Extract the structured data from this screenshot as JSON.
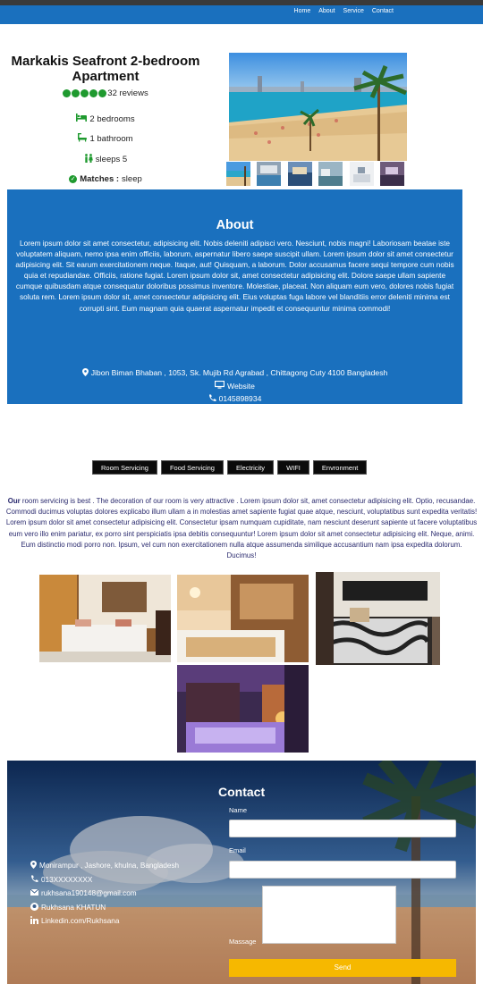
{
  "nav": {
    "links": [
      "Home",
      "About",
      "Service",
      "Contact"
    ]
  },
  "listing": {
    "title": "Markakis Seafront 2-bedroom Apartment",
    "rating_stars": 5,
    "reviews": "32 reviews",
    "bedrooms": "2 bedrooms",
    "bathrooms": "1 bathroom",
    "sleeps": "sleeps 5",
    "match_label": "Matches :",
    "match_value": "sleep"
  },
  "about": {
    "heading": "About",
    "body": "Lorem ipsum dolor sit amet consectetur, adipisicing elit. Nobis deleniti adipisci vero. Nesciunt, nobis magni! Laboriosam beatae iste voluptatem aliquam, nemo ipsa enim officiis, laborum, aspernatur libero saepe suscipit ullam. Lorem ipsum dolor sit amet consectetur adipisicing elit. Sit earum exercitationem neque. Itaque, aut! Quisquam, a laborum. Dolor accusamus facere sequi tempore cum nobis quia et repudiandae. Officiis, ratione fugiat. Lorem ipsum dolor sit, amet consectetur adipisicing elit. Dolore saepe ullam sapiente cumque quibusdam atque consequatur doloribus possimus inventore. Molestiae, placeat. Non aliquam eum vero, dolores nobis fugiat soluta rem. Lorem ipsum dolor sit, amet consectetur adipisicing elit. Eius voluptas fuga labore vel blanditiis error deleniti minima est corrupti sint. Eum magnam quia quaerat aspernatur impedit et consequuntur minima commodi!",
    "address": "Jibon Biman Bhaban , 1053, Sk. Mujib Rd Agrabad , Chittagong Cuty 4100 Bangladesh",
    "website": "Website",
    "phone": "0145898934"
  },
  "service_tabs": [
    "Room Servicing",
    "Food Servicing",
    "Electricity",
    "WIFI",
    "Envronment"
  ],
  "service": {
    "lead": "Our",
    "body": " room servicing is best . The decoration of our room is very attractive . Lorem ipsum dolor sit, amet consectetur adipisicing elit. Optio, recusandae. Commodi ducimus voluptas dolores explicabo illum ullam a in molestias amet sapiente fugiat quae atque, nesciunt, voluptatibus sunt expedita veritatis! Lorem ipsum dolor sit amet consectetur adipisicing elit. Consectetur ipsam numquam cupiditate, nam nesciunt deserunt sapiente ut facere voluptatibus eum vero illo enim pariatur, ex porro sint perspiciatis ipsa debitis consequuntur! Lorem ipsum dolor sit amet consectetur adipisicing elit. Neque, animi. Eum distinctio modi porro non. Ipsum, vel cum non exercitationem nulla atque assumenda similique accusantium nam ipsa expedita dolorum. Ducimus!"
  },
  "contact": {
    "heading": "Contact",
    "name_label": "Name",
    "email_label": "Email",
    "message_label": "Massage",
    "send_label": "Send",
    "location": "Monirampur , Jashore, khulna, Bangladesh",
    "phone": "013XXXXXXXX",
    "email": "rukhsana190148@gmail.com",
    "github": "Rukhsana KHATUN",
    "linkedin": "Linkedin.com/Rukhsana"
  },
  "colors": {
    "primary": "#1a70be",
    "accent": "#1f9a2f",
    "send": "#f6b800"
  }
}
